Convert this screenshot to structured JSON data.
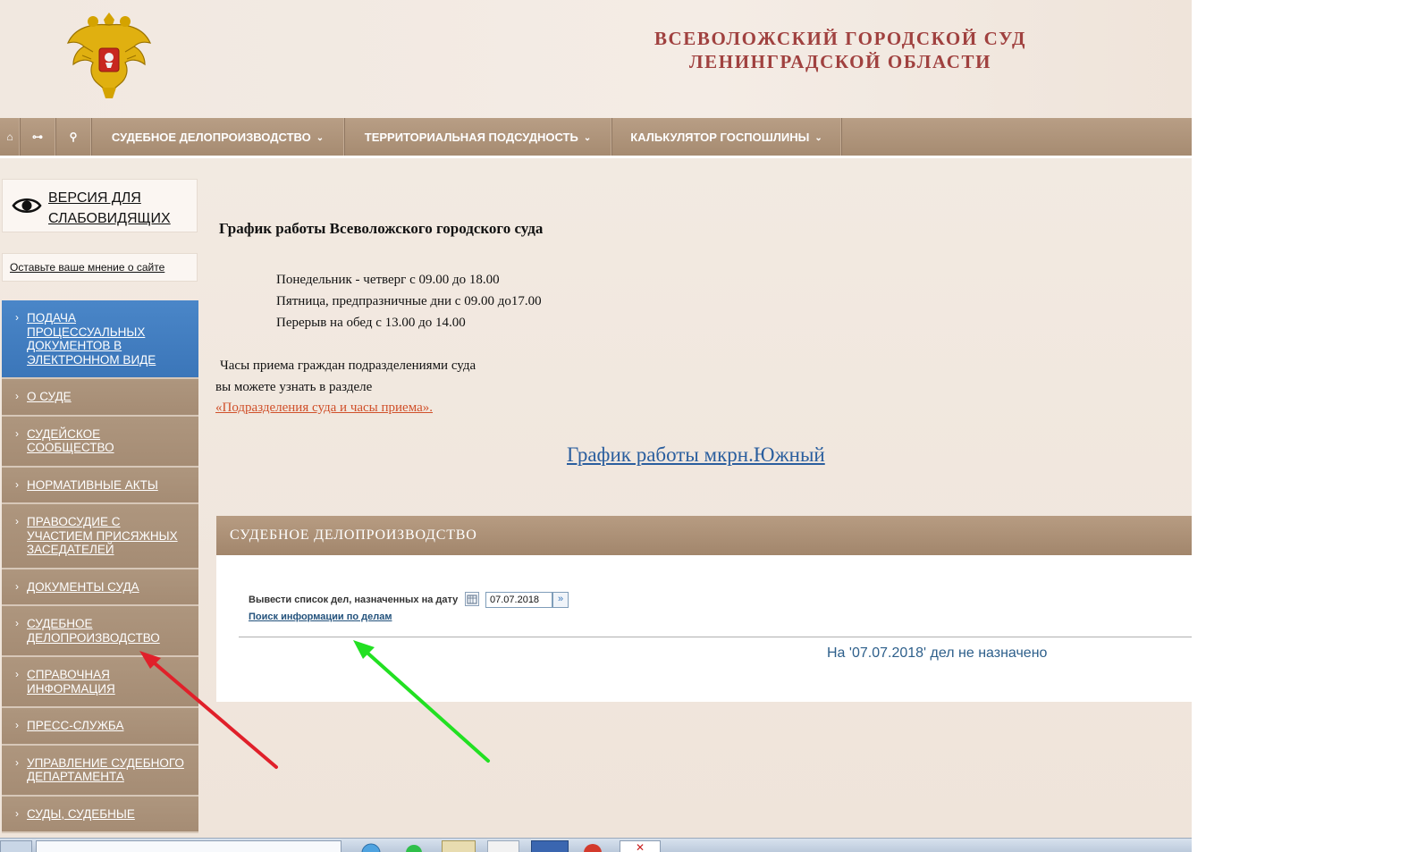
{
  "header": {
    "title_line1": "ВСЕВОЛОЖСКИЙ ГОРОДСКОЙ СУД",
    "title_line2": "ЛЕНИНГРАДСКОЙ ОБЛАСТИ",
    "emblem": "coat-of-arms-icon"
  },
  "nav": {
    "icons": [
      "home-icon",
      "sitemap-icon",
      "search-icon"
    ],
    "items": [
      {
        "label": "СУДЕБНОЕ ДЕЛОПРОИЗВОДСТВО"
      },
      {
        "label": "ТЕРРИТОРИАЛЬНАЯ ПОДСУДНОСТЬ"
      },
      {
        "label": "КАЛЬКУЛЯТОР ГОСПОШЛИНЫ"
      }
    ]
  },
  "sidebar": {
    "low_vision_label": "ВЕРСИЯ ДЛЯ СЛАБОВИДЯЩИХ",
    "feedback_label": "Оставьте ваше мнение о сайте",
    "menu": [
      {
        "label": "ПОДАЧА ПРОЦЕССУАЛЬНЫХ ДОКУМЕНТОВ В ЭЛЕКТРОННОМ ВИДЕ"
      },
      {
        "label": "О СУДЕ"
      },
      {
        "label": "СУДЕЙСКОЕ СООБЩЕСТВО"
      },
      {
        "label": "НОРМАТИВНЫЕ АКТЫ"
      },
      {
        "label": "ПРАВОСУДИЕ С УЧАСТИЕМ ПРИСЯЖНЫХ ЗАСЕДАТЕЛЕЙ"
      },
      {
        "label": "ДОКУМЕНТЫ СУДА"
      },
      {
        "label": "СУДЕБНОЕ ДЕЛОПРОИЗВОДСТВО"
      },
      {
        "label": "СПРАВОЧНАЯ ИНФОРМАЦИЯ"
      },
      {
        "label": "ПРЕСС-СЛУЖБА"
      },
      {
        "label": "УПРАВЛЕНИЕ СУДЕБНОГО ДЕПАРТАМЕНТА"
      },
      {
        "label": "СУДЫ, СУДЕБНЫЕ"
      }
    ]
  },
  "content": {
    "schedule_title": "График работы Всеволожского городского суда",
    "hours": [
      "Понедельник - четверг с 09.00 до 18.00",
      "Пятница, предпразничные дни с 09.00 до17.00",
      "Перерыв на обед с 13.00 до 14.00"
    ],
    "reception_line1": "Часы приема граждан подразделениями суда",
    "reception_line2": "вы можете  узнать в разделе",
    "dept_link": "«Подразделения суда и часы приема».",
    "south_link": "График работы мкрн.Южный"
  },
  "case_panel": {
    "header": "СУДЕБНОЕ ДЕЛОПРОИЗВОДСТВО",
    "date_label": "Вывести список дел, назначенных на дату",
    "date_value": "07.07.2018",
    "search_link": "Поиск информации по делам",
    "no_cases": "На '07.07.2018' дел не назначено"
  },
  "colors": {
    "title": "#a0413f",
    "nav": "#a68b71",
    "active_menu": "#3b76b9",
    "link_orange": "#d0502a",
    "link_blue": "#2a5e9e",
    "arrow_red": "#e0202a",
    "arrow_green": "#22e022"
  }
}
